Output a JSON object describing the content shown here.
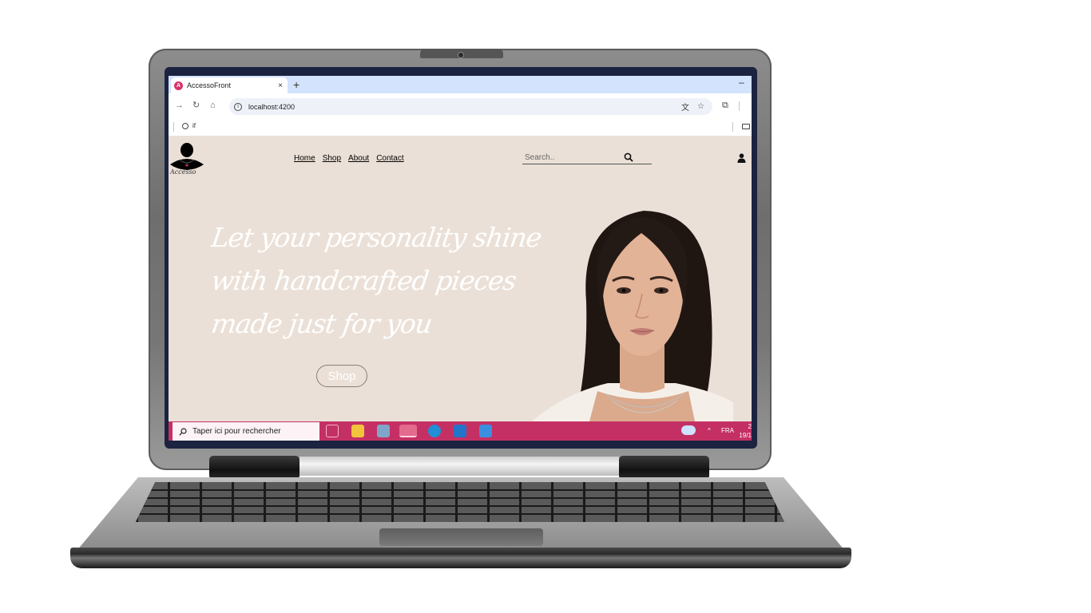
{
  "browser": {
    "tab_title": "AccessoFront",
    "new_tab": "+",
    "close_tab": "×",
    "url": "localhost:4200",
    "bookmark_label": "if",
    "minimize": "–"
  },
  "site": {
    "logo_text": "Accesso",
    "nav": [
      "Home",
      "Shop",
      "About",
      "Contact"
    ],
    "search_placeholder": "Search..",
    "hero_lines": [
      "Let your personality shine",
      "with handcrafted pieces",
      "made just for you"
    ],
    "hero_button": "Shop",
    "background_color": "#ebe0d7"
  },
  "taskbar": {
    "search_placeholder": "Taper ici pour rechercher",
    "language": "FRA",
    "time": "2",
    "date": "19/1",
    "color": "#c43064"
  }
}
